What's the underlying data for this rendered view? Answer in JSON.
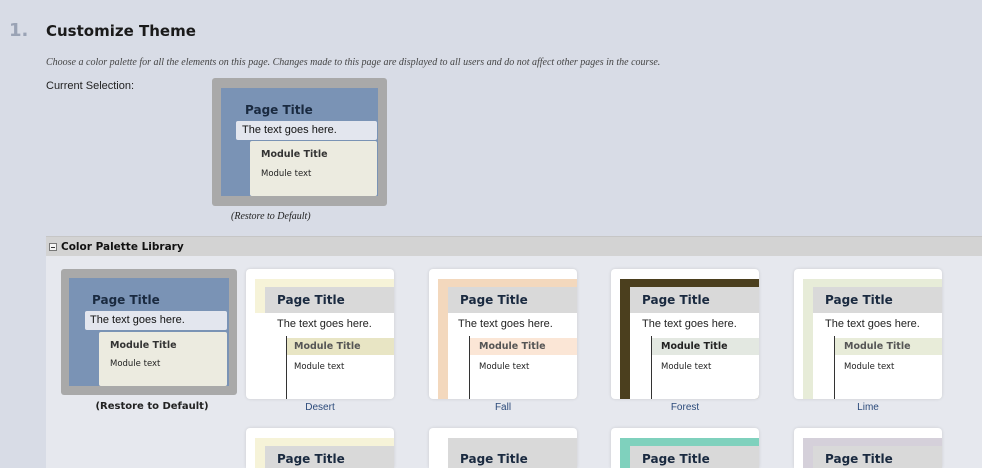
{
  "section": {
    "step": "1.",
    "title": "Customize Theme",
    "instructions": "Choose a color palette for all the elements on this page. Changes made to this page are displayed to all users and do not affect other pages in the course.",
    "current_label": "Current Selection:",
    "restore_link": "(Restore to Default)"
  },
  "preview_text": {
    "page_title": "Page Title",
    "body_text": "The text goes here.",
    "module_title": "Module Title",
    "module_text": "Module text"
  },
  "library": {
    "label": "Color Palette Library",
    "palettes": [
      {
        "name": "(Restore to Default)",
        "style": "default",
        "frame": "#a9a9a9",
        "band": "#7a93b5",
        "text_band": "#e3e6ee",
        "module_bg": "#ecebe0",
        "module_title_bg": "#ecebe0",
        "module_title_color": "#333333"
      },
      {
        "name": "Desert",
        "style": "white",
        "accent": "#f6f3d8",
        "band": "#d9d9d9",
        "module_title_bg": "#e8e5c4",
        "module_title_color": "#555555"
      },
      {
        "name": "Fall",
        "style": "white",
        "accent": "#f3d8bd",
        "band": "#d9d9d9",
        "module_title_bg": "#fbe6d6",
        "module_title_color": "#555555"
      },
      {
        "name": "Forest",
        "style": "white",
        "accent": "#4b3f1e",
        "band": "#d9d9d9",
        "module_title_bg": "#e3e8e1",
        "module_title_color": "#222222"
      },
      {
        "name": "Lime",
        "style": "white",
        "accent": "#e7ecd8",
        "band": "#d9d9d9",
        "module_title_bg": "#e8ecd9",
        "module_title_color": "#555555"
      }
    ],
    "row2": [
      {
        "accent": "#f6f3d8"
      },
      {
        "accent": "#d9d9d9"
      },
      {
        "accent": "#7fd1bd"
      },
      {
        "accent": "#d5d0da"
      }
    ]
  }
}
